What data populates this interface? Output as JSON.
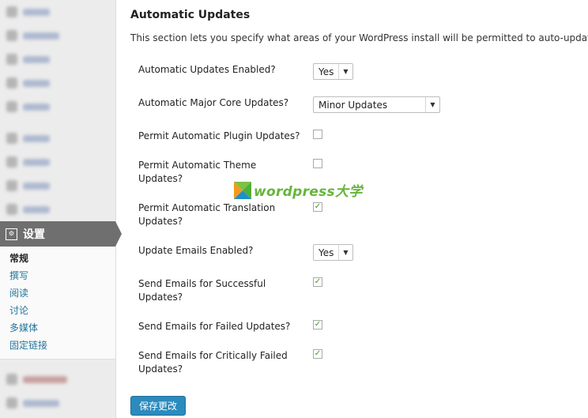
{
  "sidebar": {
    "settings_label": "设置",
    "submenu": [
      {
        "label": "常规",
        "current": true
      },
      {
        "label": "撰写",
        "current": false
      },
      {
        "label": "阅读",
        "current": false
      },
      {
        "label": "讨论",
        "current": false
      },
      {
        "label": "多媒体",
        "current": false
      },
      {
        "label": "固定链接",
        "current": false
      }
    ]
  },
  "section": {
    "title": "Automatic Updates",
    "description": "This section lets you specify what areas of your WordPress install will be permitted to auto-update."
  },
  "settings": [
    {
      "label": "Automatic Updates Enabled?",
      "type": "select",
      "value": "Yes"
    },
    {
      "label": "Automatic Major Core Updates?",
      "type": "select",
      "value": "Minor Updates"
    },
    {
      "label": "Permit Automatic Plugin Updates?",
      "type": "checkbox",
      "checked": false
    },
    {
      "label": "Permit Automatic Theme Updates?",
      "type": "checkbox",
      "checked": false
    },
    {
      "label": "Permit Automatic Translation Updates?",
      "type": "checkbox",
      "checked": true
    },
    {
      "label": "Update Emails Enabled?",
      "type": "select",
      "value": "Yes"
    },
    {
      "label": "Send Emails for Successful Updates?",
      "type": "checkbox",
      "checked": true
    },
    {
      "label": "Send Emails for Failed Updates?",
      "type": "checkbox",
      "checked": true
    },
    {
      "label": "Send Emails for Critically Failed Updates?",
      "type": "checkbox",
      "checked": true
    }
  ],
  "save_button_label": "保存更改",
  "watermark": {
    "text": "wordpress大学"
  },
  "colors": {
    "link": "#21759b",
    "button": "#2b8bbd",
    "check": "#4a8f2b",
    "watermark": "#66b53c"
  }
}
